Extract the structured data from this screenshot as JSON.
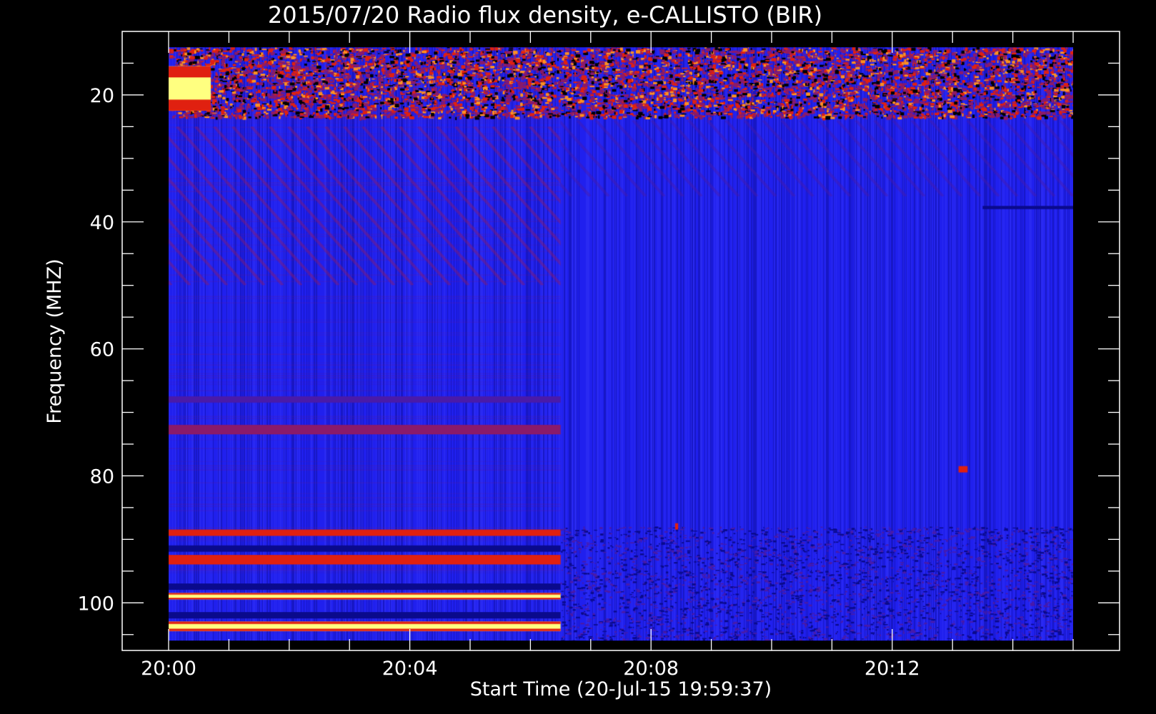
{
  "chart_data": {
    "type": "heatmap",
    "title": "2015/07/20  Radio flux density, e-CALLISTO (BIR)",
    "xlabel": "Start Time (20-Jul-15 19:59:37)",
    "ylabel": "Frequency (MHZ)",
    "x_unit": "minutes after 20:00",
    "x_major_ticks": [
      {
        "value": 0,
        "label": "20:00"
      },
      {
        "value": 4,
        "label": "20:04"
      },
      {
        "value": 8,
        "label": "20:08"
      },
      {
        "value": 12,
        "label": "20:12"
      }
    ],
    "x_minor_step": 1,
    "xlim": [
      -0.77,
      15.77
    ],
    "data_x_range": [
      0,
      15
    ],
    "y_major_ticks": [
      {
        "value": 20,
        "label": "20"
      },
      {
        "value": 40,
        "label": "40"
      },
      {
        "value": 60,
        "label": "60"
      },
      {
        "value": 80,
        "label": "80"
      },
      {
        "value": 100,
        "label": "100"
      }
    ],
    "y_minor_step": 5,
    "ylim": [
      10,
      107.5
    ],
    "y_inverted": true,
    "data_y_range": [
      12.5,
      106
    ],
    "grid": false,
    "background_level": "blue",
    "segment_break_minutes": 6.5,
    "features": [
      {
        "kind": "band",
        "x": [
          0,
          15
        ],
        "y": [
          12.5,
          23.5
        ],
        "level": "high",
        "noise": "strong"
      },
      {
        "kind": "band",
        "x": [
          0,
          0.7
        ],
        "y": [
          15.5,
          22.5
        ],
        "level": "very-high"
      },
      {
        "kind": "band",
        "x": [
          0,
          6.5
        ],
        "y": [
          72,
          73.5
        ],
        "level": "medium"
      },
      {
        "kind": "band",
        "x": [
          0,
          6.5
        ],
        "y": [
          88.5,
          89.5
        ],
        "level": "high"
      },
      {
        "kind": "band",
        "x": [
          0,
          6.5
        ],
        "y": [
          92.5,
          94
        ],
        "level": "high"
      },
      {
        "kind": "band",
        "x": [
          0,
          6.5
        ],
        "y": [
          98.5,
          99.5
        ],
        "level": "very-high"
      },
      {
        "kind": "band",
        "x": [
          0,
          6.5
        ],
        "y": [
          103,
          104.5
        ],
        "level": "very-high"
      },
      {
        "kind": "band",
        "x": [
          0,
          6.5
        ],
        "y": [
          91,
          92
        ],
        "level": "low"
      },
      {
        "kind": "band",
        "x": [
          0,
          6.5
        ],
        "y": [
          97,
          98
        ],
        "level": "low"
      },
      {
        "kind": "band",
        "x": [
          0,
          6.5
        ],
        "y": [
          101.5,
          102.5
        ],
        "level": "low"
      },
      {
        "kind": "band",
        "x": [
          0,
          6.5
        ],
        "y": [
          67.5,
          68.5
        ],
        "level": "low-medium"
      },
      {
        "kind": "band",
        "x": [
          0,
          6.5
        ],
        "y": [
          25,
          50
        ],
        "level": "medium",
        "noise": "drifting-stripes"
      },
      {
        "kind": "band",
        "x": [
          6.5,
          15
        ],
        "y": [
          24,
          36
        ],
        "level": "low-medium",
        "noise": "drifting-stripes"
      },
      {
        "kind": "band",
        "x": [
          6.5,
          15
        ],
        "y": [
          88,
          106
        ],
        "level": "low-medium",
        "noise": "speckle"
      },
      {
        "kind": "spot",
        "x": [
          13.1,
          13.25
        ],
        "y": [
          78.5,
          79.5
        ],
        "level": "high"
      },
      {
        "kind": "spot",
        "x": [
          8.4,
          8.45
        ],
        "y": [
          87.5,
          88.5
        ],
        "level": "high"
      },
      {
        "kind": "band",
        "x": [
          13.5,
          15
        ],
        "y": [
          37.5,
          38
        ],
        "level": "low"
      }
    ],
    "colors": {
      "background": "#000000",
      "axis": "#ffffff",
      "very-low": "#000000",
      "low": "#0a0a8c",
      "base": "#2020ee",
      "low-medium": "#4a1aa8",
      "medium": "#8a1a6a",
      "high": "#e02010",
      "very-high": "#ffff80"
    }
  }
}
